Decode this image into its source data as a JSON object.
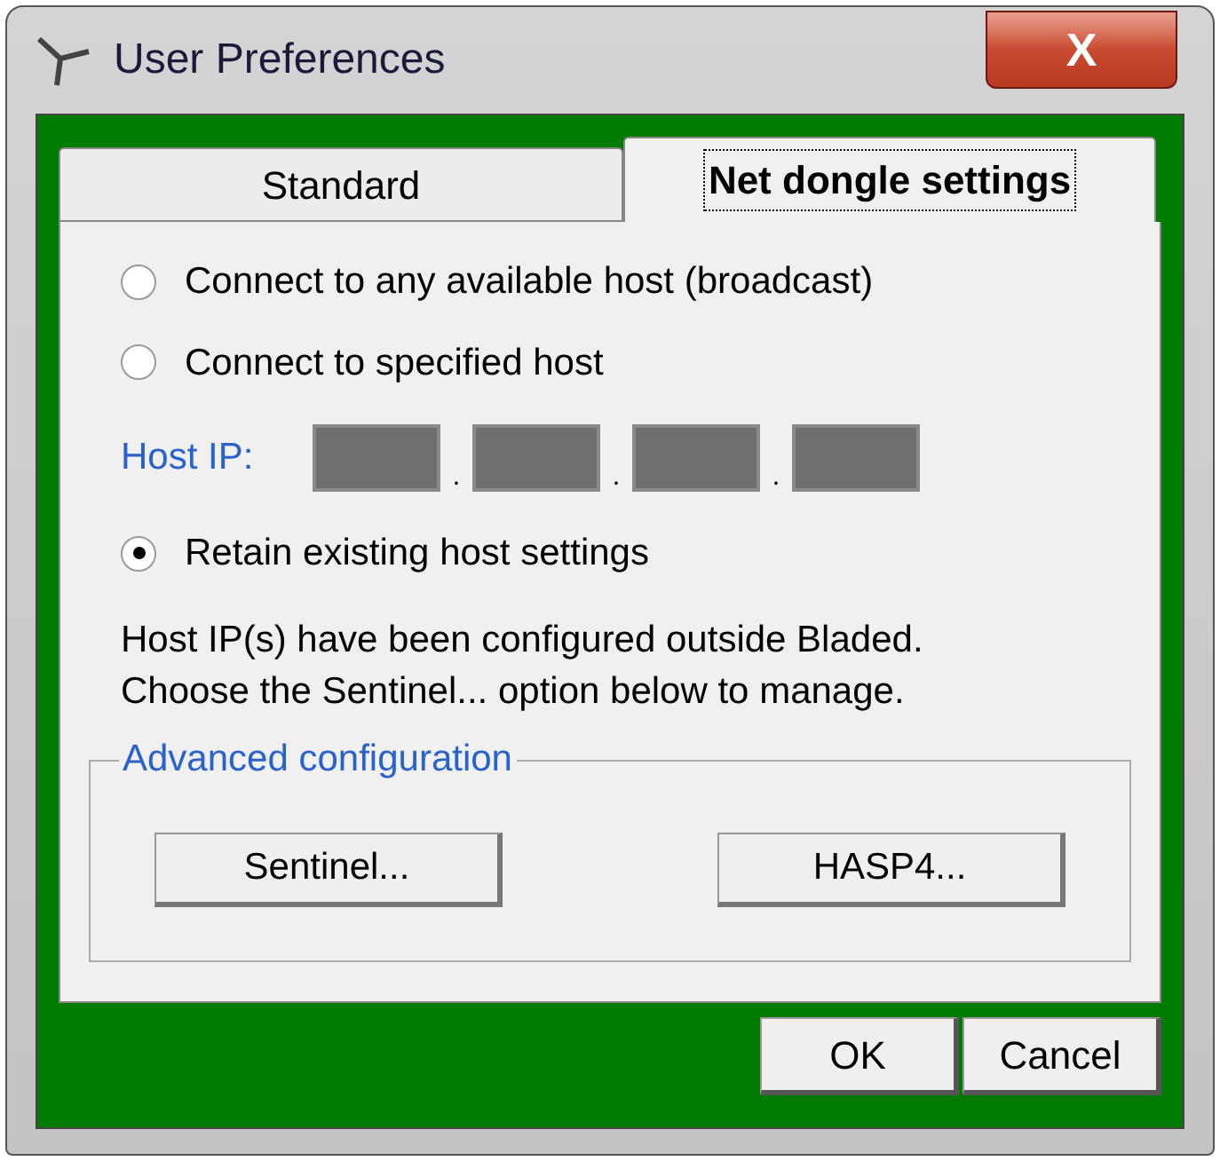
{
  "window": {
    "title": "User Preferences",
    "close": "X"
  },
  "tabs": [
    {
      "label": "Standard",
      "selected": false
    },
    {
      "label": "Net dongle settings",
      "selected": true
    }
  ],
  "options": [
    {
      "label": "Connect to any available host (broadcast)",
      "selected": false
    },
    {
      "label": "Connect to specified host",
      "selected": false
    }
  ],
  "host_ip": {
    "label": "Host IP:",
    "fields": [
      {
        "disabled": true
      },
      {
        "disabled": true
      },
      {
        "disabled": true
      },
      {
        "disabled": true
      }
    ],
    "separators": [
      ".",
      ".",
      "."
    ]
  },
  "retain_option": {
    "label": "Retain existing host settings",
    "selected": true
  },
  "note": [
    "Host IP(s) have been configured outside Bladed.",
    "Choose the Sentinel... option below to manage."
  ],
  "advanced": {
    "title": "Advanced configuration",
    "buttons": [
      "Sentinel...",
      "HASP4..."
    ]
  },
  "buttons": [
    "OK",
    "Cancel"
  ]
}
